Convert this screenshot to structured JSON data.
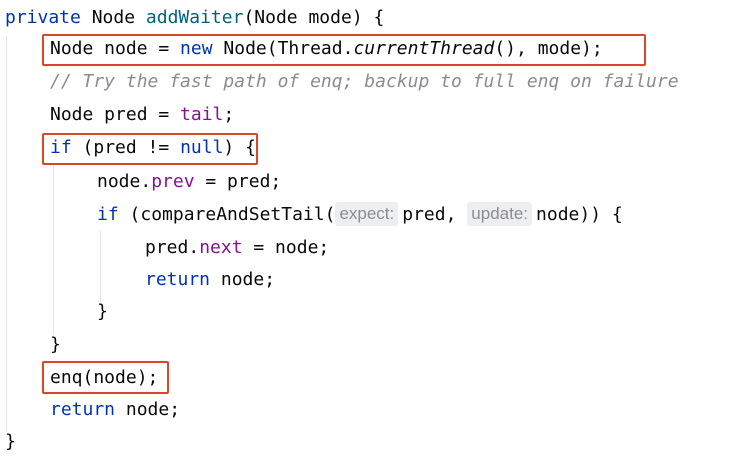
{
  "code": {
    "line1": {
      "kw_private": "private",
      "type": "Node",
      "method_name": "addWaiter",
      "params": "(Node mode) {"
    },
    "line2": {
      "decl": "Node node = ",
      "kw_new": "new",
      "ctor_open": " Node(Thread.",
      "current_thread": "currentThread",
      "ctor_close": "(), mode);"
    },
    "line3": {
      "comment": "// Try the fast path of enq; backup to full enq on failure"
    },
    "line4": {
      "decl": "Node pred = ",
      "field_tail": "tail",
      "semi": ";"
    },
    "line5": {
      "kw_if": "if",
      "cond_open": " (pred != ",
      "kw_null": "null",
      "cond_close": ")",
      "brace": " {"
    },
    "line6": {
      "obj": "node.",
      "field_prev": "prev",
      "rest": " = pred;"
    },
    "line7": {
      "kw_if": "if",
      "call_open": " (compareAndSetTail(",
      "hint_expect": "expect:",
      "arg1": "pred, ",
      "hint_update": "update:",
      "arg2": "node)) {"
    },
    "line8": {
      "obj": "pred.",
      "field_next": "next",
      "rest": " = node;"
    },
    "line9": {
      "kw_return": "return",
      "rest": " node;"
    },
    "line10": {
      "text": "}"
    },
    "line11": {
      "text": "}"
    },
    "line12": {
      "text": "enq(node);"
    },
    "line13": {
      "kw_return": "return",
      "rest": " node;"
    },
    "line14": {
      "text": "}"
    }
  },
  "colors": {
    "keyword": "#0033b3",
    "method": "#00627a",
    "field": "#871094",
    "comment": "#8c8c8c",
    "highlight_box": "#d9472b"
  }
}
